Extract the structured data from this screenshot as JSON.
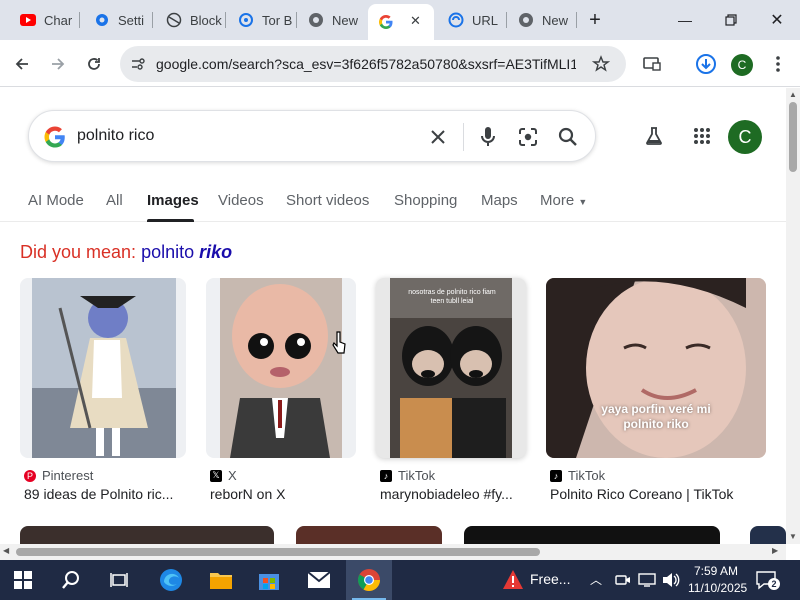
{
  "browser": {
    "tabs": [
      {
        "label": "Char",
        "icon": "youtube-icon"
      },
      {
        "label": "Setti",
        "icon": "settings-icon"
      },
      {
        "label": "Block",
        "icon": "globe-icon"
      },
      {
        "label": "Tor B",
        "icon": "tor-icon"
      },
      {
        "label": "New",
        "icon": "chrome-icon"
      },
      {
        "label": "",
        "icon": "google-icon",
        "active": true
      },
      {
        "label": "URL",
        "icon": "url-icon"
      },
      {
        "label": "New",
        "icon": "chrome-icon"
      }
    ],
    "url": "google.com/search?sca_esv=3f626f5782a50780&sxsrf=AE3TifMLI1...",
    "profile_initial": "C"
  },
  "search": {
    "query": "polnito rico",
    "profile_initial": "C"
  },
  "nav": {
    "items": [
      "AI Mode",
      "All",
      "Images",
      "Videos",
      "Short videos",
      "Shopping",
      "Maps",
      "More"
    ],
    "active": "Images"
  },
  "didyoumean": {
    "prefix": "Did you mean:",
    "suggestion_plain": "polnito",
    "suggestion_emph": "riko"
  },
  "results": [
    {
      "source": "Pinterest",
      "title": "89 ideas de Polnito ric...",
      "overlay": ""
    },
    {
      "source": "X",
      "title": "reborN on X",
      "overlay": ""
    },
    {
      "source": "TikTok",
      "title": "marynobiadeleo #fy...",
      "overlay": "nosotras de polnito rico fiam teen tubll leial"
    },
    {
      "source": "TikTok",
      "title": "Polnito Rico Coreano | TikTok",
      "overlay": "yaya porfin veré mi polnito riko"
    }
  ],
  "taskbar": {
    "time": "7:59 AM",
    "date": "11/10/2025",
    "app_text": "Free...",
    "notification_count": "2"
  },
  "colors": {
    "google_blue": "#4285f4",
    "google_red": "#ea4335",
    "google_yellow": "#fbbc05",
    "google_green": "#34a853",
    "didyoumean_red": "#d93025",
    "link_blue": "#1a0dab",
    "taskbar": "#1f2a44"
  }
}
